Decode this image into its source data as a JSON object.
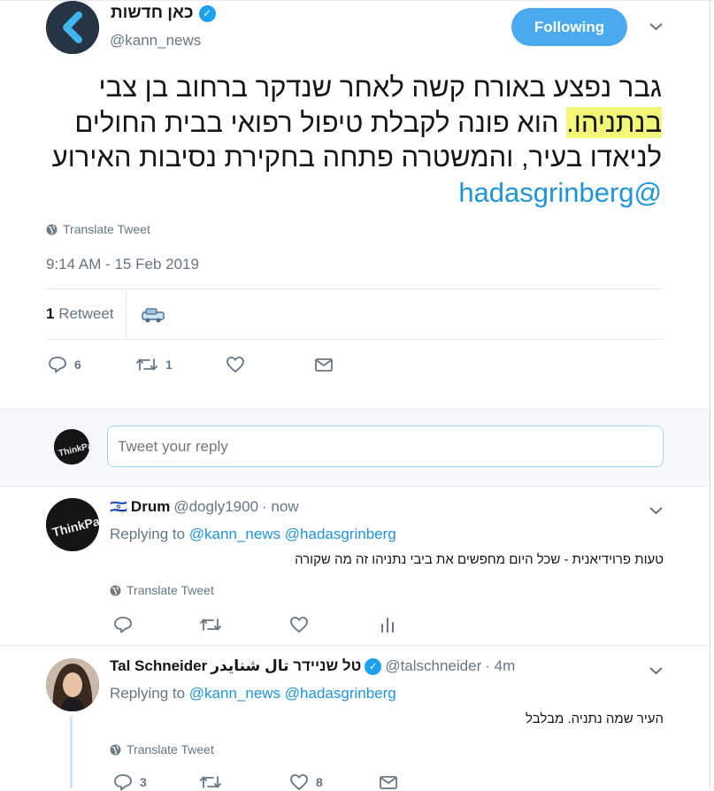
{
  "main_tweet": {
    "author_name": "כאן חדשות",
    "handle": "@kann_news",
    "follow_label": "Following",
    "text_before_highlight": "גבר נפצע באורח קשה לאחר שנדקר ברחוב בן צבי ",
    "text_highlight": "בנתניהו.",
    "text_after_highlight": " הוא פונה לקבלת טיפול רפואי בבית החולים לניאדו בעיר, והמשטרה פתחה בחקירת נסיבות האירוע ",
    "text_mention": "@hadasgrinberg",
    "translate_label": "Translate Tweet",
    "timestamp": "9:14 AM - 15 Feb 2019",
    "retweet_count": "1",
    "retweet_label": "Retweet",
    "reply_count": "6",
    "retweet_action_count": "1"
  },
  "reply_box": {
    "placeholder": "Tweet your reply"
  },
  "replies": [
    {
      "flag": "🇮🇱",
      "name": "Drum",
      "handle": "@dogly1900",
      "time": "· now",
      "replying_prefix": "Replying to",
      "mention1": "@kann_news",
      "mention2": "@hadasgrinberg",
      "text": "טעות פרוידיאנית - שכל היום מחפשים את ביבי נתניהו זה מה שקורה",
      "translate_label": "Translate Tweet"
    },
    {
      "name": "Tal Schneider",
      "name_rtl": "טל שניידר تال شنايدر",
      "handle": "@talschneider",
      "time": "· 4m",
      "replying_prefix": "Replying to",
      "mention1": "@kann_news",
      "mention2": "@hadasgrinberg",
      "text": "העיר שמה נתניה. מבלבל",
      "translate_label": "Translate Tweet",
      "reply_count": "3",
      "like_count": "8"
    }
  ],
  "icons": {
    "verified": "verified-badge-icon",
    "globe": "globe-icon",
    "reply": "reply-icon",
    "retweet": "retweet-icon",
    "like": "heart-icon",
    "dm": "envelope-icon",
    "analytics": "analytics-icon"
  },
  "colors": {
    "accent": "#1da1f2",
    "follow_button": "#4aaaef",
    "highlight": "#f4f67a",
    "link": "#1b95e0",
    "muted": "#657786"
  }
}
